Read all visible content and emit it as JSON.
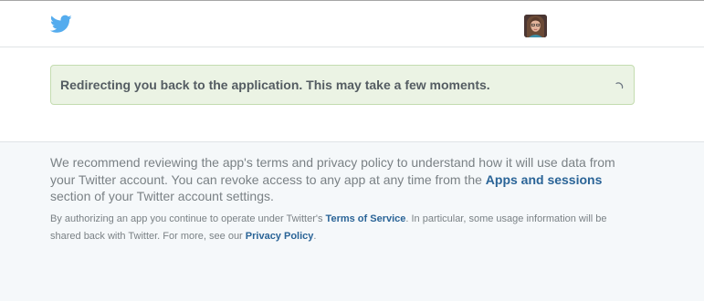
{
  "icons": {
    "brand": "twitter-bird-icon",
    "avatar": "user-avatar",
    "spinner": "loading-spinner-icon"
  },
  "colors": {
    "brand": "#55acee",
    "link": "#2a6497",
    "notice_bg": "#ebf3e4",
    "notice_border": "#c4dcb0",
    "footer_bg": "#f5f8fa"
  },
  "notice": {
    "message": "Redirecting you back to the application. This may take a few moments."
  },
  "footer": {
    "main_text_1": "We recommend reviewing the app's terms and privacy policy to understand how it will use data from your Twitter account. You can revoke access to any app at any time from the ",
    "apps_link": "Apps and sessions",
    "main_text_2": " section of your Twitter account settings.",
    "small_text_1": "By authorizing an app you continue to operate under Twitter's ",
    "tos_link": "Terms of Service",
    "small_text_2": ". In particular, some usage information will be shared back with Twitter. For more, see our ",
    "privacy_link": "Privacy Policy",
    "small_text_3": "."
  }
}
